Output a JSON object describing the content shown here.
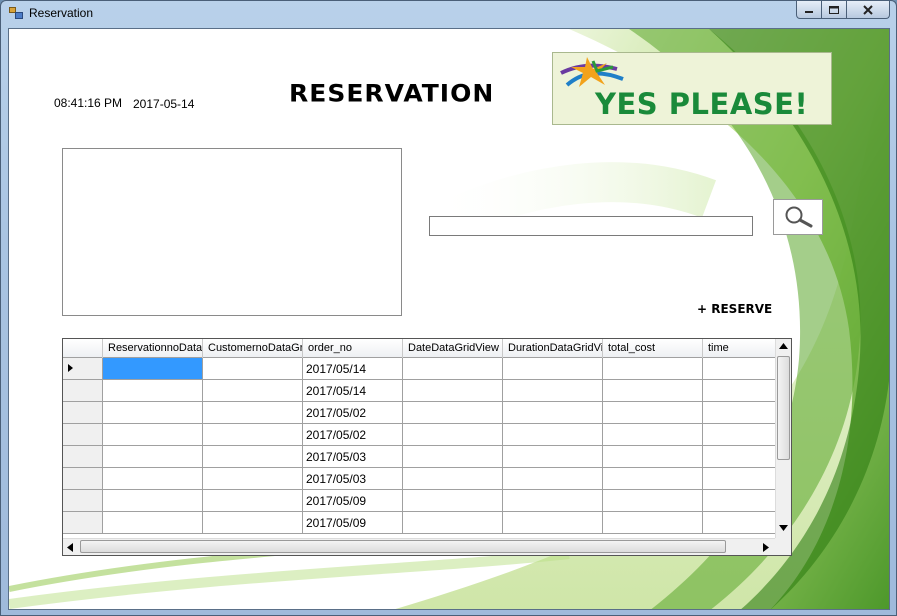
{
  "window": {
    "title": "Reservation"
  },
  "header": {
    "time": "08:41:16 PM",
    "date": "2017-05-14",
    "heading": "RESERVATION",
    "logo_text": "YES PLEASE!"
  },
  "search": {
    "value": "",
    "icon": "magnifier-icon"
  },
  "actions": {
    "reserve_label": "+ RESERVE"
  },
  "grid": {
    "columns": [
      "ReservationnoData",
      "CustomernoDataGri",
      "order_no",
      "DateDataGridView",
      "DurationDataGridVi",
      "total_cost",
      "time"
    ],
    "rows": [
      [
        "",
        "",
        "2017/05/14",
        "",
        "",
        "",
        ""
      ],
      [
        "",
        "",
        "2017/05/14",
        "",
        "",
        "",
        ""
      ],
      [
        "",
        "",
        "2017/05/02",
        "",
        "",
        "",
        ""
      ],
      [
        "",
        "",
        "2017/05/02",
        "",
        "",
        "",
        ""
      ],
      [
        "",
        "",
        "2017/05/03",
        "",
        "",
        "",
        ""
      ],
      [
        "",
        "",
        "2017/05/03",
        "",
        "",
        "",
        ""
      ],
      [
        "",
        "",
        "2017/05/09",
        "",
        "",
        "",
        ""
      ],
      [
        "",
        "",
        "2017/05/09",
        "",
        "",
        "",
        ""
      ]
    ],
    "selected_row": 0,
    "selected_col": 0
  },
  "colors": {
    "selection": "#3399ff",
    "logo_green": "#1a8a3a",
    "leaf_green": "#7fc241"
  }
}
